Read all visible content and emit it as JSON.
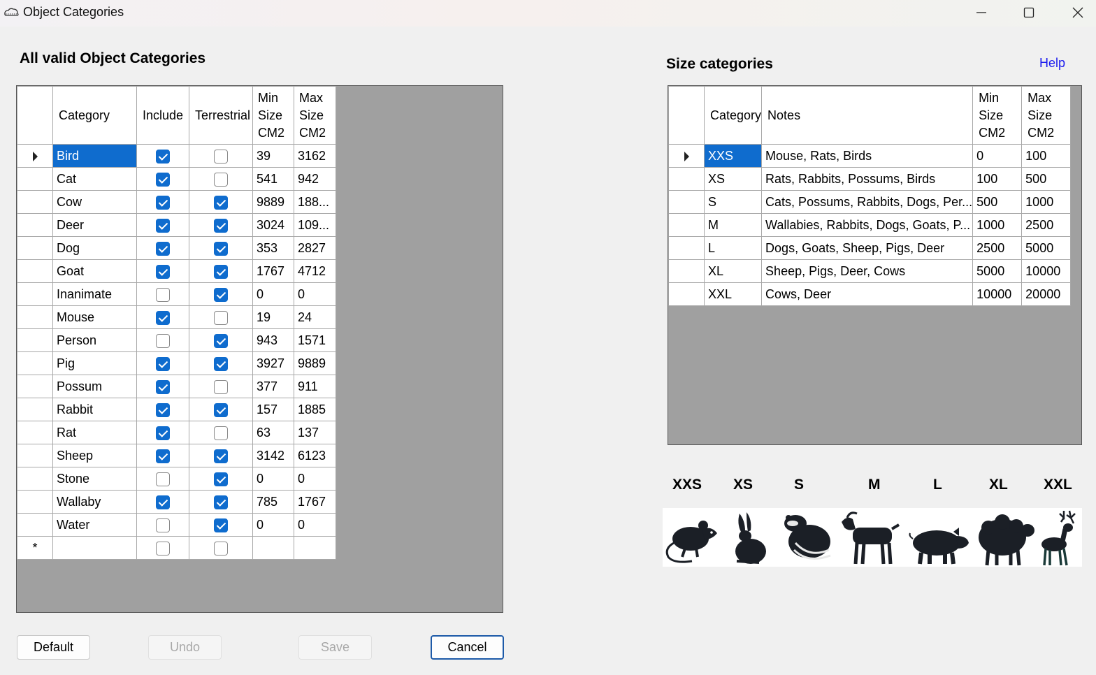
{
  "window": {
    "title": "Object Categories",
    "icons": [
      "app-icon",
      "minimize-icon",
      "maximize-icon",
      "close-icon"
    ]
  },
  "left_panel": {
    "heading": "All valid Object Categories",
    "columns": [
      "Category",
      "Include",
      "Terrestrial",
      "Min Size CM2",
      "Max Size CM2"
    ],
    "rows": [
      {
        "category": "Bird",
        "include": true,
        "terrestrial": false,
        "min": "39",
        "max": "3162",
        "selected": true
      },
      {
        "category": "Cat",
        "include": true,
        "terrestrial": false,
        "min": "541",
        "max": "942"
      },
      {
        "category": "Cow",
        "include": true,
        "terrestrial": true,
        "min": "9889",
        "max": "188..."
      },
      {
        "category": "Deer",
        "include": true,
        "terrestrial": true,
        "min": "3024",
        "max": "109..."
      },
      {
        "category": "Dog",
        "include": true,
        "terrestrial": true,
        "min": "353",
        "max": "2827"
      },
      {
        "category": "Goat",
        "include": true,
        "terrestrial": true,
        "min": "1767",
        "max": "4712"
      },
      {
        "category": "Inanimate",
        "include": false,
        "terrestrial": true,
        "min": "0",
        "max": "0"
      },
      {
        "category": "Mouse",
        "include": true,
        "terrestrial": false,
        "min": "19",
        "max": "24"
      },
      {
        "category": "Person",
        "include": false,
        "terrestrial": true,
        "min": "943",
        "max": "1571"
      },
      {
        "category": "Pig",
        "include": true,
        "terrestrial": true,
        "min": "3927",
        "max": "9889"
      },
      {
        "category": "Possum",
        "include": true,
        "terrestrial": false,
        "min": "377",
        "max": "911"
      },
      {
        "category": "Rabbit",
        "include": true,
        "terrestrial": true,
        "min": "157",
        "max": "1885"
      },
      {
        "category": "Rat",
        "include": true,
        "terrestrial": false,
        "min": "63",
        "max": "137"
      },
      {
        "category": "Sheep",
        "include": true,
        "terrestrial": true,
        "min": "3142",
        "max": "6123"
      },
      {
        "category": "Stone",
        "include": false,
        "terrestrial": true,
        "min": "0",
        "max": "0"
      },
      {
        "category": "Wallaby",
        "include": true,
        "terrestrial": true,
        "min": "785",
        "max": "1767"
      },
      {
        "category": "Water",
        "include": false,
        "terrestrial": true,
        "min": "0",
        "max": "0"
      }
    ],
    "new_row_marker": "*"
  },
  "right_panel": {
    "heading": "Size categories",
    "help_link": "Help",
    "columns": [
      "Category",
      "Notes",
      "Min Size CM2",
      "Max Size CM2"
    ],
    "rows": [
      {
        "category": "XXS",
        "notes": "Mouse, Rats, Birds",
        "min": "0",
        "max": "100",
        "selected": true
      },
      {
        "category": "XS",
        "notes": "Rats, Rabbits, Possums, Birds",
        "min": "100",
        "max": "500"
      },
      {
        "category": "S",
        "notes": "Cats, Possums, Rabbits, Dogs, Per...",
        "min": "500",
        "max": "1000"
      },
      {
        "category": "M",
        "notes": "Wallabies, Rabbits, Dogs, Goats, P...",
        "min": "1000",
        "max": "2500"
      },
      {
        "category": "L",
        "notes": "Dogs, Goats, Sheep, Pigs, Deer",
        "min": "2500",
        "max": "5000"
      },
      {
        "category": "XL",
        "notes": "Sheep, Pigs, Deer, Cows",
        "min": "5000",
        "max": "10000"
      },
      {
        "category": "XXL",
        "notes": "Cows, Deer",
        "min": "10000",
        "max": "20000"
      }
    ]
  },
  "size_strip": {
    "labels": [
      "XXS",
      "XS",
      "S",
      "M",
      "L",
      "XL",
      "XXL"
    ],
    "animal_icons": [
      "rat-icon",
      "rabbit-icon",
      "possum-icon",
      "goat-icon",
      "pig-icon",
      "sheep-icon",
      "deer-icon"
    ]
  },
  "buttons": {
    "default": "Default",
    "undo": "Undo",
    "save": "Save",
    "cancel": "Cancel"
  }
}
